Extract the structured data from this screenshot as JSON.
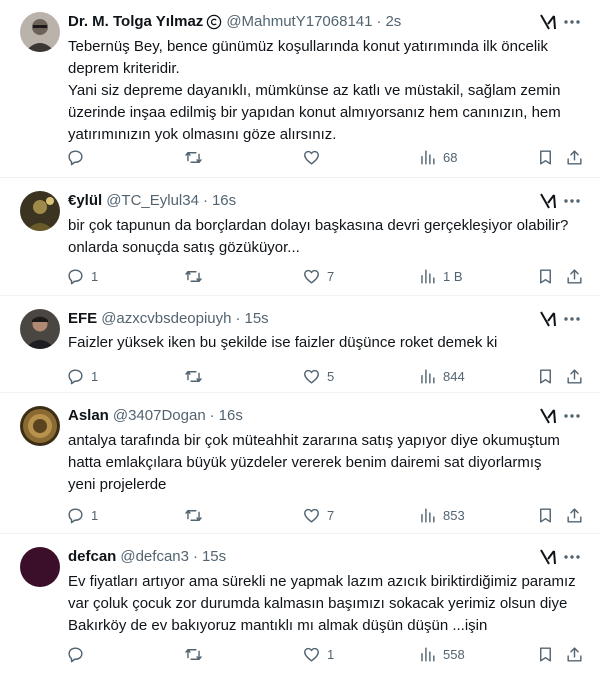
{
  "tweets": [
    {
      "name": "Dr. M. Tolga Yılmaz",
      "handle": "@MahmutY17068141",
      "time": "2s",
      "lines": [
        "Tebernüş Bey, bence günümüz koşullarında konut yatırımında ilk öncelik",
        "deprem kriteridir.",
        "Yani siz depreme dayanıklı, mümkünse az katlı ve müstakil, sağlam zemin",
        "üzerinde inşaa edilmiş bir yapıdan konut almıyorsanız hem canınızın, hem",
        "yatırımınızın yok olmasını göze alırsınız."
      ],
      "replies": "",
      "retweets": "",
      "likes": "",
      "views": "68",
      "avatar_color": "#6d6258"
    },
    {
      "name": "€ylül",
      "handle": "@TC_Eylul34",
      "time": "16s",
      "lines": [
        "bir çok tapunun da borçlardan dolayı başkasına devri gerçekleşiyor olabilir?",
        "onlarda sonuçda satış gözüküyor..."
      ],
      "replies": "1",
      "retweets": "",
      "likes": "7",
      "views": "1 B",
      "avatar_color": "#7a6a2e"
    },
    {
      "name": "EFE",
      "handle": "@azxcvbsdeopiuyh",
      "time": "15s",
      "lines": [
        "Faizler yüksek iken bu şekilde ise faizler düşünce roket demek ki"
      ],
      "replies": "1",
      "retweets": "",
      "likes": "5",
      "views": "844",
      "avatar_color": "#2c2a2a"
    },
    {
      "name": "Aslan",
      "handle": "@3407Dogan",
      "time": "16s",
      "lines": [
        "antalya tarafında bir çok müteahhit zararına satış yapıyor diye okumuştum",
        "hatta emlakçılara büyük yüzdeler vererek benim dairemi sat diyorlarmış",
        "yeni projelerde"
      ],
      "replies": "1",
      "retweets": "",
      "likes": "7",
      "views": "853",
      "avatar_color": "#8a6a32"
    },
    {
      "name": "defcan",
      "handle": "@defcan3",
      "time": "15s",
      "lines": [
        "Ev fiyatları artıyor ama sürekli ne yapmak lazım azıcık biriktirdiğimiz paramız",
        "var çoluk çocuk zor durumda kalmasın başımızı sokacak yerimiz olsun diye",
        "Bakırköy de ev bakıyoruz mantıklı mı almak düşün düşün ...işin"
      ],
      "replies": "",
      "retweets": "",
      "likes": "1",
      "views": "558",
      "avatar_color": "#3b0f2a"
    }
  ]
}
